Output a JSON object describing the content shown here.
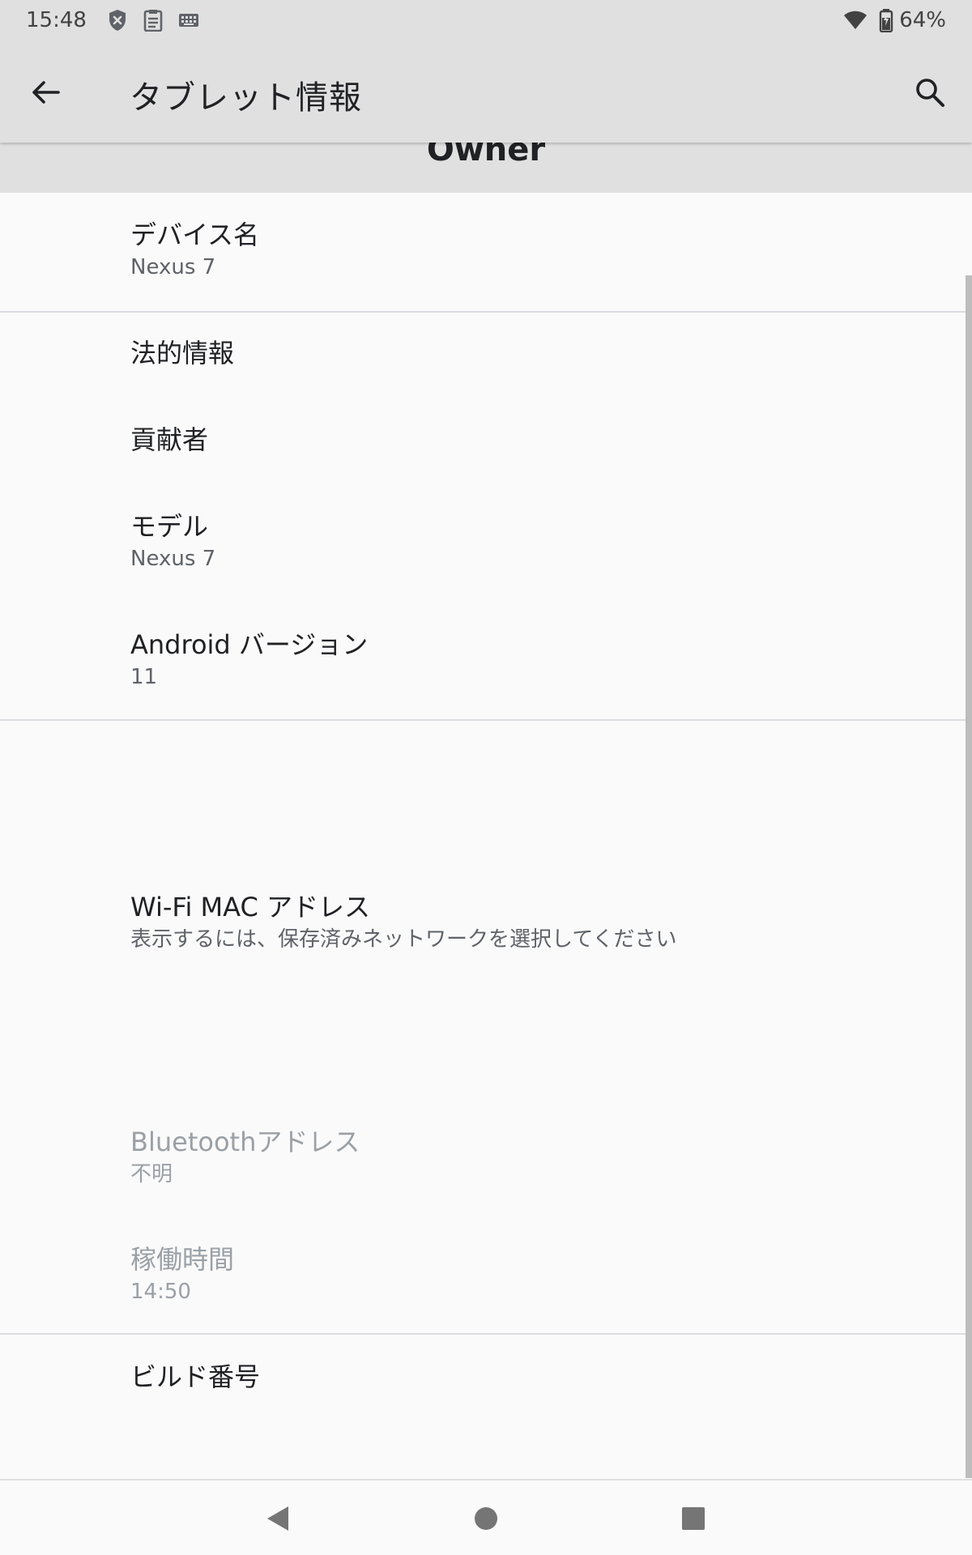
{
  "status_bar": {
    "time": "15:48",
    "icons": [
      "shield-x-icon",
      "clipboard-icon",
      "keyboard-icon"
    ],
    "battery_percent": "64%"
  },
  "app_bar": {
    "title": "タブレット情報"
  },
  "header": {
    "owner_label": "Owner"
  },
  "items": [
    {
      "title": "デバイス名",
      "subtitle": "Nexus 7"
    },
    {
      "title": "法的情報"
    },
    {
      "title": "貢献者"
    },
    {
      "title": "モデル",
      "subtitle": "Nexus 7"
    },
    {
      "title": "Android バージョン",
      "subtitle": "11"
    },
    {
      "title": "Wi-Fi MAC アドレス",
      "subtitle": "表示するには、保存済みネットワークを選択してください"
    },
    {
      "title": "Bluetoothアドレス",
      "subtitle": "不明",
      "disabled": true
    },
    {
      "title": "稼働時間",
      "subtitle": "14:50",
      "disabled": true
    },
    {
      "title": "ビルド番号"
    }
  ],
  "colors": {
    "bar_background": "#e0e0e0",
    "page_background": "#fafafa",
    "primary_text": "#202124",
    "secondary_text": "#5f6368",
    "disabled_text": "#9aa0a6"
  }
}
